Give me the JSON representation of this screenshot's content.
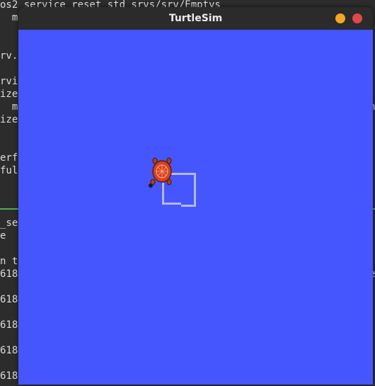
{
  "terminal": {
    "lines": [
      "os2 service reset std srvs/srv/Emptys",
      "  ma",
      "",
      "",
      "rv.",
      "",
      "rvi",
      "ize",
      "  ma",
      "ize",
      "",
      "",
      "erf",
      "ful",
      "",
      "",
      "",
      "_se",
      "e",
      "",
      "n t",
      "618",
      "",
      "618",
      "",
      "",
      "618",
      "",
      "618",
      "",
      "618"
    ],
    "right_chars": [
      "",
      "",
      "",
      "",
      "",
      "",
      "",
      "",
      "n",
      "",
      "",
      "",
      "",
      "",
      "",
      "",
      "",
      "",
      "",
      "",
      "",
      "e",
      "",
      "",
      "",
      "",
      "",
      "",
      "",
      "",
      ""
    ]
  },
  "window": {
    "title": "TurtleSim",
    "minimize_color": "#f5a623",
    "close_color": "#e0484d"
  },
  "canvas": {
    "background_color": "#4556ff",
    "pen_color": "#b3b8ff",
    "turtle_icon": "turtle-icon"
  }
}
